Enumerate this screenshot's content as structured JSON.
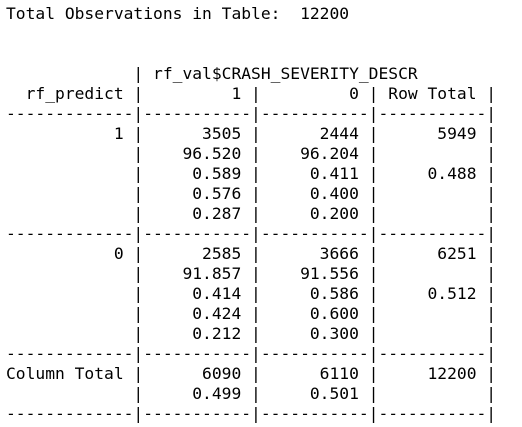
{
  "title_line": "Total Observations in Table:  12200",
  "table_lines": [
    "",
    "",
    "             | rf_val$CRASH_SEVERITY_DESCR",
    "  rf_predict |         1 |         0 | Row Total |",
    "-------------|-----------|-----------|-----------|",
    "           1 |      3505 |      2444 |      5949 |",
    "             |    96.520 |    96.204 |           |",
    "             |     0.589 |     0.411 |     0.488 |",
    "             |     0.576 |     0.400 |           |",
    "             |     0.287 |     0.200 |           |",
    "-------------|-----------|-----------|-----------|",
    "           0 |      2585 |      3666 |      6251 |",
    "             |    91.857 |    91.556 |           |",
    "             |     0.414 |     0.586 |     0.512 |",
    "             |     0.424 |     0.600 |           |",
    "             |     0.212 |     0.300 |           |",
    "-------------|-----------|-----------|-----------|",
    "Column Total |      6090 |      6110 |     12200 |",
    "             |     0.499 |     0.501 |           |",
    "-------------|-----------|-----------|-----------|"
  ]
}
